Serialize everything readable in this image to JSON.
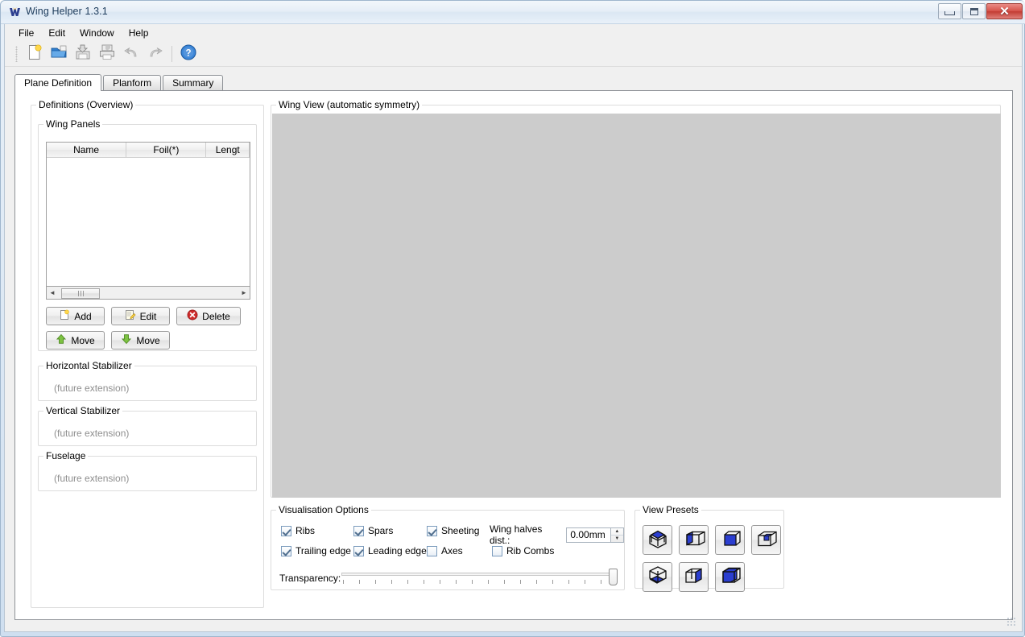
{
  "window": {
    "title": "Wing Helper 1.3.1",
    "icon": "wing-helper-logo-icon",
    "buttons": {
      "minimize": "–",
      "maximize": "□",
      "close": "✕"
    }
  },
  "menubar": {
    "items": [
      "File",
      "Edit",
      "Window",
      "Help"
    ]
  },
  "toolbar": {
    "items": [
      {
        "name": "new-file-icon",
        "tooltip": "New"
      },
      {
        "name": "open-folder-icon",
        "tooltip": "Open"
      },
      {
        "name": "save-icon",
        "tooltip": "Save"
      },
      {
        "name": "print-icon",
        "tooltip": "Print"
      },
      {
        "name": "undo-icon",
        "tooltip": "Undo"
      },
      {
        "name": "redo-icon",
        "tooltip": "Redo"
      },
      {
        "name": "help-icon",
        "tooltip": "Help"
      }
    ]
  },
  "tabs": [
    {
      "label": "Plane Definition",
      "active": true
    },
    {
      "label": "Planform",
      "active": false
    },
    {
      "label": "Summary",
      "active": false
    }
  ],
  "definitions": {
    "legend": "Definitions (Overview)",
    "wing_panels": {
      "legend": "Wing Panels",
      "columns": [
        "Name",
        "Foil(*)",
        "Lengt"
      ],
      "rows": [],
      "scroll_left_arrow": "◄",
      "scroll_right_arrow": "►"
    },
    "buttons": {
      "add": "Add",
      "edit": "Edit",
      "delete": "Delete",
      "move_up": "Move",
      "move_down": "Move"
    },
    "horizontal_stabilizer": {
      "legend": "Horizontal Stabilizer",
      "content": "(future extension)"
    },
    "vertical_stabilizer": {
      "legend": "Vertical Stabilizer",
      "content": "(future extension)"
    },
    "fuselage": {
      "legend": "Fuselage",
      "content": "(future extension)"
    }
  },
  "wing_view": {
    "legend": "Wing View (automatic symmetry)",
    "background_color": "#cccccc"
  },
  "visualisation_options": {
    "legend": "Visualisation Options",
    "checkboxes": [
      {
        "label": "Ribs",
        "checked": true
      },
      {
        "label": "Spars",
        "checked": true
      },
      {
        "label": "Sheeting",
        "checked": true
      },
      {
        "label": "Trailing edge",
        "checked": true
      },
      {
        "label": "Leading edge",
        "checked": true
      },
      {
        "label": "Axes",
        "checked": false
      },
      {
        "label": "Rib Combs",
        "checked": false
      }
    ],
    "wing_halves": {
      "label": "Wing halves dist.:",
      "value": "0.00mm"
    },
    "transparency": {
      "label": "Transparency:",
      "value": 100,
      "min": 0,
      "max": 100,
      "ticks": 18
    }
  },
  "view_presets": {
    "legend": "View Presets",
    "items": [
      {
        "name": "preset-top-view",
        "face": "top"
      },
      {
        "name": "preset-left-view",
        "face": "left"
      },
      {
        "name": "preset-front-view",
        "face": "front"
      },
      {
        "name": "preset-inside-view",
        "face": "inside"
      },
      {
        "name": "preset-bottom-view",
        "face": "bottom"
      },
      {
        "name": "preset-right-view",
        "face": "right"
      },
      {
        "name": "preset-iso-view",
        "face": "iso"
      }
    ]
  }
}
